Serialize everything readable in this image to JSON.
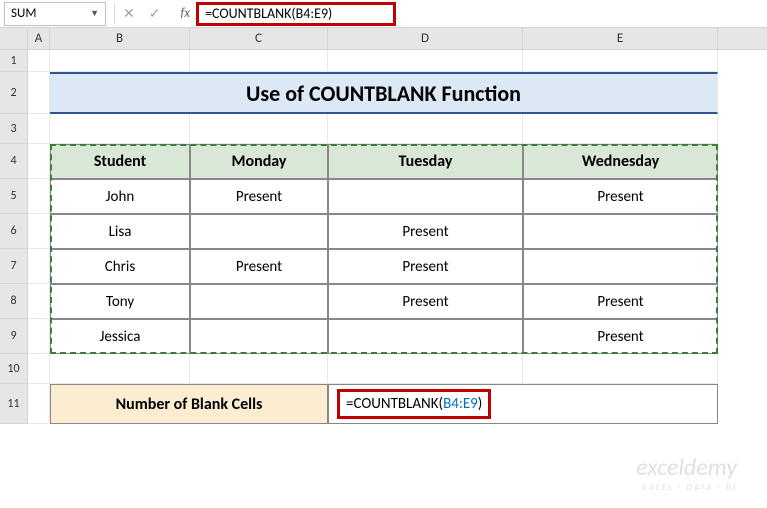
{
  "namebox": {
    "value": "SUM",
    "dropdown": "▼"
  },
  "fb_icons": {
    "cancel": "✕",
    "enter": "✓"
  },
  "fx_label": "fx",
  "formula_bar": "=COUNTBLANK(B4:E9)",
  "cols": {
    "A": "A",
    "B": "B",
    "C": "C",
    "D": "D",
    "E": "E"
  },
  "rows": {
    "r1": "1",
    "r2": "2",
    "r3": "3",
    "r4": "4",
    "r5": "5",
    "r6": "6",
    "r7": "7",
    "r8": "8",
    "r9": "9",
    "r10": "10",
    "r11": "11"
  },
  "title": "Use of COUNTBLANK Function",
  "headers": {
    "b": "Student",
    "c": "Monday",
    "d": "Tuesday",
    "e": "Wednesday"
  },
  "data": [
    {
      "b": "John",
      "c": "Present",
      "d": "",
      "e": "Present"
    },
    {
      "b": "Lisa",
      "c": "",
      "d": "Present",
      "e": ""
    },
    {
      "b": "Chris",
      "c": "Present",
      "d": "Present",
      "e": ""
    },
    {
      "b": "Tony",
      "c": "",
      "d": "Present",
      "e": "Present"
    },
    {
      "b": "Jessica",
      "c": "",
      "d": "",
      "e": "Present"
    }
  ],
  "result_label": "Number of Blank Cells",
  "result_formula_prefix": "=COUNTBLANK(",
  "result_formula_ref": "B4:E9",
  "result_formula_suffix": ")",
  "watermark": {
    "main": "exceldemy",
    "sub": "EXCEL · DATA · BI"
  },
  "chart_data": {
    "type": "table",
    "title": "Use of COUNTBLANK Function",
    "columns": [
      "Student",
      "Monday",
      "Tuesday",
      "Wednesday"
    ],
    "rows": [
      [
        "John",
        "Present",
        "",
        "Present"
      ],
      [
        "Lisa",
        "",
        "Present",
        ""
      ],
      [
        "Chris",
        "Present",
        "Present",
        ""
      ],
      [
        "Tony",
        "",
        "Present",
        "Present"
      ],
      [
        "Jessica",
        "",
        "",
        "Present"
      ]
    ],
    "formula_cell": "D11",
    "formula": "=COUNTBLANK(B4:E9)"
  }
}
